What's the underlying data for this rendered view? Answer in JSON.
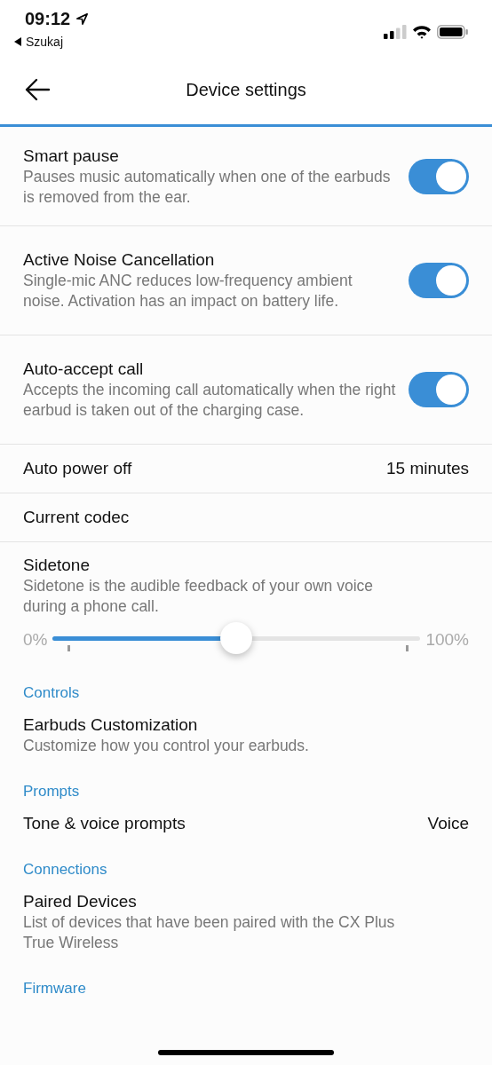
{
  "status_bar": {
    "time": "09:12",
    "back_label": "Szukaj"
  },
  "nav": {
    "title": "Device settings"
  },
  "settings": [
    {
      "kind": "toggle",
      "title": "Smart pause",
      "description": "Pauses music automatically when one of the earbuds is removed from the ear.",
      "on": true
    },
    {
      "kind": "toggle",
      "title": "Active Noise Cancellation",
      "description": "Single-mic ANC reduces low-frequency ambient noise. Activation has an impact on battery life.",
      "on": true
    },
    {
      "kind": "toggle",
      "title": "Auto-accept call",
      "description": "Accepts the incoming call automatically when the right earbud is taken out of the charging case.",
      "on": true
    },
    {
      "kind": "value",
      "title": "Auto power off",
      "value": "15 minutes"
    },
    {
      "kind": "plain",
      "title": "Current codec"
    },
    {
      "kind": "slider",
      "title": "Sidetone",
      "description": "Sidetone is the audible feedback of your own voice during a phone call.",
      "min_label": "0%",
      "max_label": "100%",
      "level": 0.5
    }
  ],
  "sections": [
    {
      "title": "Controls",
      "items": [
        {
          "title": "Earbuds Customization",
          "description": "Customize how you control your earbuds."
        }
      ]
    },
    {
      "title": "Prompts",
      "items": [
        {
          "title": "Tone & voice prompts",
          "value": "Voice"
        }
      ]
    },
    {
      "title": "Connections",
      "items": [
        {
          "title": "Paired Devices",
          "description": "List of devices that have been paired with the CX Plus True Wireless"
        }
      ]
    },
    {
      "title": "Firmware"
    }
  ]
}
